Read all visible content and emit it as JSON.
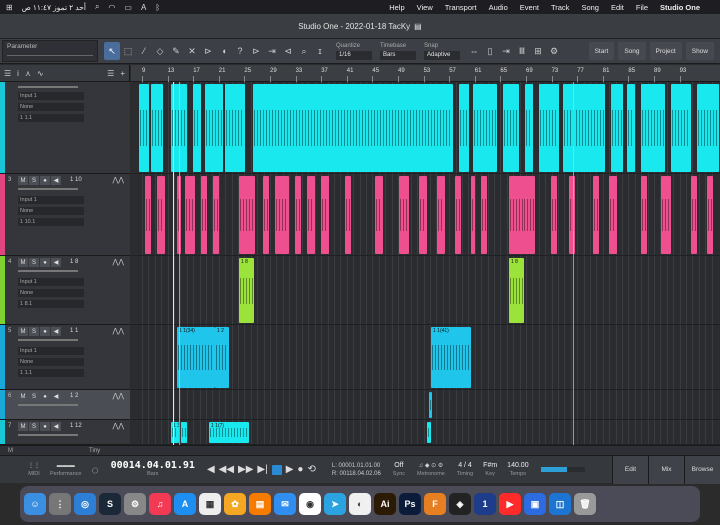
{
  "menubar": {
    "app_name": "Studio One",
    "items": [
      "File",
      "Edit",
      "Song",
      "Track",
      "Event",
      "Audio",
      "Transport",
      "View",
      "Help"
    ],
    "clock": "أحد ٢ تموز ١١:٤٧ ص"
  },
  "window": {
    "title": "Studio One - 2022-01-18 TacKy"
  },
  "toolbar": {
    "parameter_label": "Parameter",
    "quantize_label": "Quantize",
    "quantize_value": "1/16",
    "timebase_label": "Timebase",
    "timebase_value": "Bars",
    "snap_label": "Snap",
    "snap_value": "Adaptive",
    "start_label": "Start",
    "song_label": "Song",
    "project_label": "Project",
    "show_label": "Show"
  },
  "ruler_ticks": [
    "9",
    "13",
    "17",
    "21",
    "25",
    "29",
    "33",
    "37",
    "41",
    "45",
    "49",
    "53",
    "57",
    "61",
    "65",
    "69",
    "73",
    "77",
    "81",
    "85",
    "89",
    "93"
  ],
  "tracks": [
    {
      "num": "",
      "name": "",
      "input": "Input 1",
      "insert": "None",
      "io": "1 1.1",
      "color": "#19c6d6"
    },
    {
      "num": "3",
      "name": "1 10",
      "input": "Input 1",
      "insert": "None",
      "io": "1 10.1",
      "color": "#e0457f"
    },
    {
      "num": "4",
      "name": "1 8",
      "input": "Input 1",
      "insert": "None",
      "io": "1 8.1",
      "color": "#7fd030"
    },
    {
      "num": "5",
      "name": "1 1",
      "input": "Input 1",
      "insert": "None",
      "io": "1 1.1",
      "color": "#19a8d8"
    },
    {
      "num": "6",
      "name": "1 2",
      "input": "",
      "insert": "",
      "io": "",
      "color": "#19a8d8"
    },
    {
      "num": "7",
      "name": "1 12",
      "input": "",
      "insert": "",
      "io": "",
      "color": "#19c6d6"
    }
  ],
  "track_buttons": {
    "mute": "M",
    "solo": "S"
  },
  "clip_labels": {
    "t4": "1 8",
    "t5a": "1 1(34)",
    "t5b": "1 2",
    "t5c": "1 1(41)",
    "t7a": "1 3",
    "t7b": "1 1(7)"
  },
  "lower_strip": {
    "m_label": "M",
    "size_label": "Tiny"
  },
  "transport": {
    "midi_label": "MIDI",
    "performance_label": "Performance",
    "position": "00014.04.01.91",
    "position_unit": "Bars",
    "loop_start": "00001.01.01.00",
    "loop_end": "00118.04.02.06",
    "sync_value": "Off",
    "sync_label": "Sync",
    "metronome_label": "Metronome",
    "timing_value": "4 / 4",
    "timing_label": "Timing",
    "key_value": "F#m",
    "key_label": "Key",
    "tempo_value": "140.00",
    "tempo_label": "Tempo",
    "edit_label": "Edit",
    "mix_label": "Mix",
    "browse_label": "Browse"
  },
  "dock_apps": [
    {
      "icon": "finder-icon",
      "color": "#3b8fe0"
    },
    {
      "icon": "launchpad-icon",
      "color": "#777"
    },
    {
      "icon": "safari-icon",
      "color": "#2d7fd6"
    },
    {
      "icon": "steam-icon",
      "color": "#1b2838"
    },
    {
      "icon": "settings-icon",
      "color": "#888"
    },
    {
      "icon": "music-icon",
      "color": "#f23a55"
    },
    {
      "icon": "appstore-icon",
      "color": "#1f8ef1"
    },
    {
      "icon": "calendar-icon",
      "color": "#eee"
    },
    {
      "icon": "photos-icon",
      "color": "#f5a623"
    },
    {
      "icon": "books-icon",
      "color": "#f57c00"
    },
    {
      "icon": "mail-icon",
      "color": "#2f8ef0"
    },
    {
      "icon": "contacts-icon",
      "color": "#fff"
    },
    {
      "icon": "telegram-icon",
      "color": "#2aa3e0"
    },
    {
      "icon": "chrome-icon",
      "color": "#f0f0f0"
    },
    {
      "icon": "illustrator-icon",
      "color": "#2b1b05"
    },
    {
      "icon": "photoshop-icon",
      "color": "#0a1c3a"
    },
    {
      "icon": "flstudio-icon",
      "color": "#e67e22"
    },
    {
      "icon": "logic-icon",
      "color": "#222"
    },
    {
      "icon": "studioone-icon",
      "color": "#1d3d8a"
    },
    {
      "icon": "youtube-icon",
      "color": "#ff2a2a"
    },
    {
      "icon": "keynote-icon",
      "color": "#2d6be0"
    },
    {
      "icon": "files-icon",
      "color": "#1b75d1"
    },
    {
      "icon": "trash-icon",
      "color": "#999"
    }
  ]
}
